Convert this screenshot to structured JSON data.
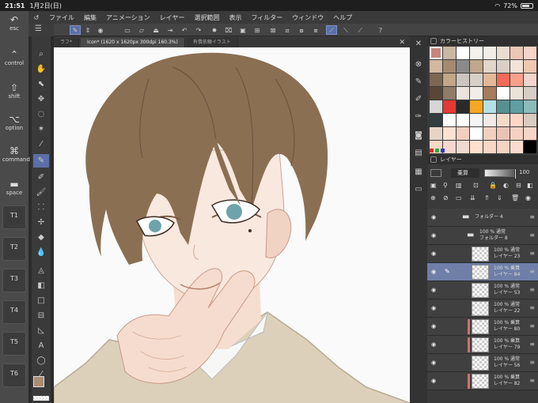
{
  "status": {
    "time": "21:51",
    "date": "1月2日(日)",
    "battery": "72%",
    "battery_level": 0.72
  },
  "menu": {
    "items": [
      "ファイル",
      "編集",
      "アニメーション",
      "レイヤー",
      "選択範囲",
      "表示",
      "フィルター",
      "ウィンドウ",
      "ヘルプ"
    ]
  },
  "edgebar": {
    "esc": "esc",
    "control": "control",
    "shift": "shift",
    "option": "option",
    "command": "command",
    "space": "space",
    "t1": "T1",
    "t2": "T2",
    "t3": "T3",
    "t4": "T4",
    "t5": "T5",
    "t6": "T6"
  },
  "tabs": [
    {
      "label": "ラフ*"
    },
    {
      "label": "Icon* (1620 x 1620px 300dpi 160.3%)"
    },
    {
      "label": "有償依頼イラスト"
    }
  ],
  "color_panel": {
    "title": "カラーヒストリー",
    "swatches": [
      "#c9857e",
      "#c9b7a2",
      "#ffffff",
      "#f4f2ee",
      "#f1eee8",
      "#e9dcd0",
      "#eac6b5",
      "#f7d3c8",
      "#d3b9a2",
      "#a48a70",
      "#8a8a8a",
      "#bfa68d",
      "#e2d5c9",
      "#d9cfc6",
      "#f1e3d7",
      "#f0c7b0",
      "#7d6750",
      "#c3a587",
      "#cbc4bf",
      "#d8cfc6",
      "#e4b896",
      "#f16a5a",
      "#f9a08a",
      "#f3d5cc",
      "#5a4636",
      "#8f7b69",
      "#ebe3dc",
      "#f2ede8",
      "#a67b5b",
      "#ffffff",
      "#ebe2d8",
      "#d7cdc5",
      "#d6d6d6",
      "#e53935",
      "#2a2a2a",
      "#f5a623",
      "#b3e0e8",
      "#5a8f8f",
      "#5f9ea0",
      "#8bbcbc",
      "#333c3f",
      "#ffffff",
      "#ffffff",
      "#f5f5f5",
      "#f0ebe7",
      "#f6dac9",
      "#ffd6c7",
      "#d9cbbe",
      "#e6d5c6",
      "#fde2d0",
      "#f4cfc0",
      "#ffffff",
      "#f2d0c0",
      "#e9c4b5",
      "#f6d1c3",
      "#f7d6c7",
      "#fbd9c4",
      "#f4d8cc",
      "#f0d9ce",
      "#ffe0cc",
      "#f8d7c6",
      "#f7d3c3",
      "#f9dccd",
      "#000000"
    ]
  },
  "layer_panel": {
    "title": "レイヤー",
    "blend_mode": "乗算",
    "opacity": "100",
    "opacity_level": 1.0,
    "layers": [
      {
        "line1": "フォルダー 4",
        "line2": "",
        "type": "folder"
      },
      {
        "line1": "100 % 通常",
        "line2": "フォルダー 8",
        "type": "folder"
      },
      {
        "line1": "100 % 通常",
        "line2": "レイヤー 23",
        "type": "layer"
      },
      {
        "line1": "100 % 乗算",
        "line2": "レイヤー 84",
        "type": "layer",
        "selected": true
      },
      {
        "line1": "100 % 通常",
        "line2": "レイヤー 53",
        "type": "layer"
      },
      {
        "line1": "100 % 通常",
        "line2": "レイヤー 22",
        "type": "layer"
      },
      {
        "line1": "100 % 乗算",
        "line2": "レイヤー 80",
        "type": "layer",
        "clip": true
      },
      {
        "line1": "100 % 乗算",
        "line2": "レイヤー 79",
        "type": "layer",
        "clip": true
      },
      {
        "line1": "100 % 通常",
        "line2": "レイヤー 56",
        "type": "layer"
      },
      {
        "line1": "100 % 乗算",
        "line2": "レイヤー 82",
        "type": "layer",
        "clip": true
      }
    ]
  },
  "colors": {
    "accent": "#5b6fa8",
    "hair": "#8a6c4e",
    "skin": "#f6e3d6",
    "eye": "#6fa3ab",
    "sweater": "#d9ccb6",
    "main_color": "#a98c74"
  }
}
